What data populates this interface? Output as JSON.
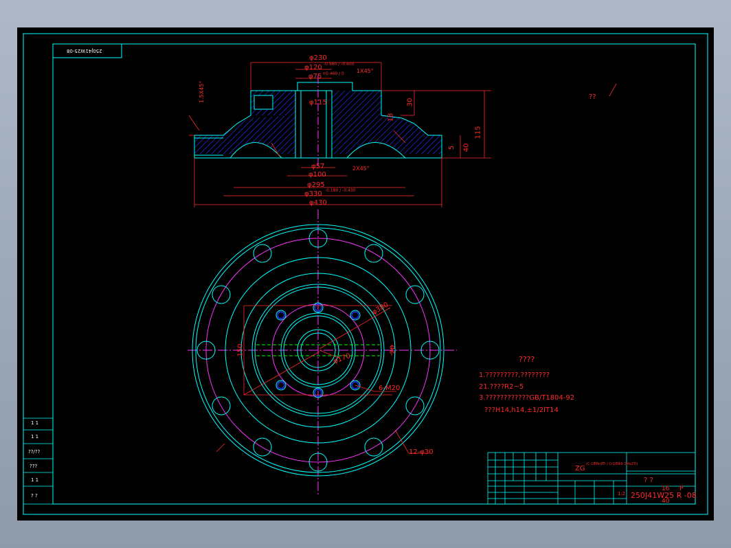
{
  "dimensions": {
    "d230": "φ230",
    "d120": "φ120",
    "d120_tol": "-0.560 / -0.600",
    "d75": "φ75",
    "d75_tol": "+0.460 / 0",
    "chamfer_1x45": "1X45°",
    "d115": "φ115",
    "d57": "φ57",
    "d100": "φ100",
    "d295": "φ295",
    "d330": "φ330",
    "d330_tol": "-0.180 / -0.430",
    "d430": "φ430",
    "chamfer_2x45": "2X45°",
    "chamfer_15x45": "1.5X45°",
    "h115": "115",
    "h40": "40",
    "h30": "30",
    "h5": "5",
    "h18": "18",
    "d380": "φ380",
    "d170": "φ170",
    "d150": "150",
    "d20": "20",
    "holes_6m20": "6-M20",
    "holes_12d30": "12-φ30",
    "rough": "??"
  },
  "notes": {
    "title": "????",
    "line1": "1.?????????,????????",
    "line2": "21.????R2~5",
    "line3": "3.????????????GB/T1804-92",
    "line4": "???H14,h14,±1/2IT14"
  },
  "title_block": {
    "material": "ZG",
    "material_sub": "(C-18Mn9Ti / Cr18Ni9 2Mo2Ti)",
    "part_name": "? ?",
    "drawing_no": "250J41W25 R -08",
    "scale": "1:2",
    "qty": "16",
    "weight": "40",
    "sheet": "P"
  },
  "left_strip": {
    "r1": "1  1",
    "r2": "1  1",
    "r3": "??/??",
    "r4": "???",
    "r5": "1  1",
    "r6": "?  ?"
  },
  "corner_code": "250J41W25-08",
  "colors": {
    "background": "#000000",
    "frame": "#00ffff",
    "dimension": "#ff2a2a",
    "centerline": "#ff33ff",
    "hatch": "#0000ff",
    "hidden": "#00ff00",
    "outline": "#ffffff"
  }
}
